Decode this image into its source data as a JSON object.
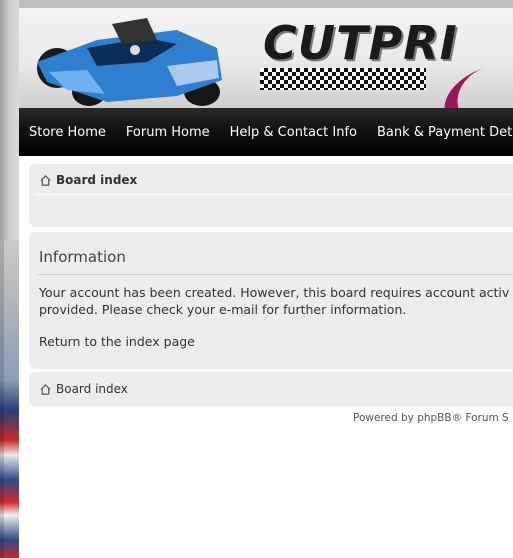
{
  "header": {
    "logo_text": "CUTPRI",
    "kart_image": "go-kart-image"
  },
  "nav": {
    "items": [
      "Store Home",
      "Forum Home",
      "Help & Contact Info",
      "Bank & Payment Details"
    ]
  },
  "breadcrumb_top": {
    "label": "Board index",
    "icon": "home-icon"
  },
  "info": {
    "title": "Information",
    "line1": "Your account has been created. However, this board requires account activ",
    "line2": "provided. Please check your e-mail for further information.",
    "return_link": "Return to the index page"
  },
  "breadcrumb_bottom": {
    "label": "Board index",
    "icon": "home-icon"
  },
  "footer": {
    "powered": "Powered by phpBB® Forum S"
  },
  "colors": {
    "nav_bg": "#000000",
    "panel_bg": "#ececec",
    "accent_swoosh": "#9d1558",
    "kart_blue": "#2f7fd0"
  }
}
